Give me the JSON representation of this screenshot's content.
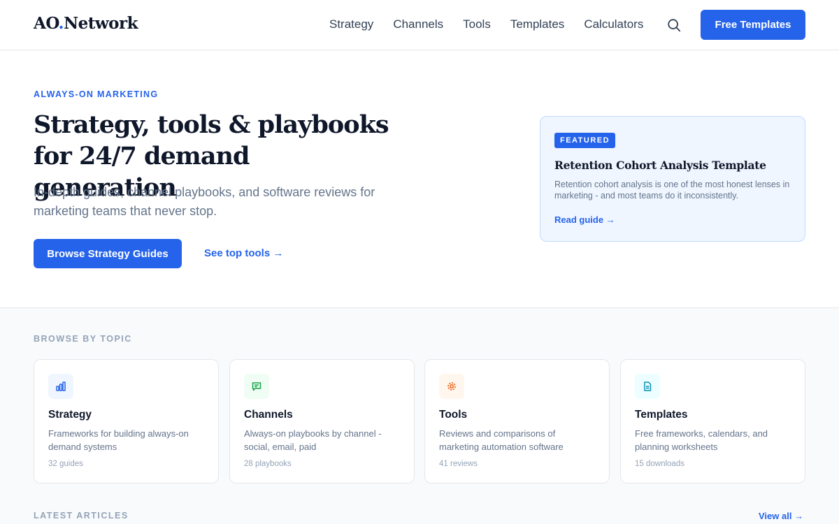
{
  "header": {
    "logo_main": "AO",
    "logo_dot": ".",
    "logo_rest": "Network",
    "nav": [
      "Strategy",
      "Channels",
      "Tools",
      "Templates",
      "Calculators"
    ],
    "cta": "Free Templates",
    "search_icon": "search-icon"
  },
  "hero": {
    "eyebrow": "ALWAYS-ON MARKETING",
    "title_line1": "Strategy, tools & playbooks",
    "title_line2": "for 24/7 demand generation",
    "subtitle": "In-depth guides, channel playbooks, and software reviews for marketing teams that never stop.",
    "primary_button": "Browse Strategy Guides",
    "secondary_link": "See top tools →"
  },
  "featured": {
    "badge": "FEATURED",
    "title": "Retention Cohort Analysis Template",
    "description": "Retention cohort analysis is one of the most honest lenses in marketing - and most teams do it inconsistently.",
    "link": "Read guide →"
  },
  "topics": {
    "label": "BROWSE BY TOPIC",
    "cards": [
      {
        "title": "Strategy",
        "description": "Frameworks for building always-on demand systems",
        "count": "32 guides",
        "icon": "bar-chart-icon",
        "color": "#2563eb",
        "bg": "#eff6ff"
      },
      {
        "title": "Channels",
        "description": "Always-on playbooks by channel - social, email, paid",
        "count": "28 playbooks",
        "icon": "chat-icon",
        "color": "#16a34a",
        "bg": "#f0fdf4"
      },
      {
        "title": "Tools",
        "description": "Reviews and comparisons of marketing automation software",
        "count": "41 reviews",
        "icon": "gear-icon",
        "color": "#ea580c",
        "bg": "#fff7ed"
      },
      {
        "title": "Templates",
        "description": "Free frameworks, calendars, and planning worksheets",
        "count": "15 downloads",
        "icon": "document-icon",
        "color": "#0891b2",
        "bg": "#ecfeff"
      }
    ]
  },
  "latest": {
    "label": "LATEST ARTICLES",
    "view_all": "View all →"
  },
  "colors": {
    "accent": "#2563eb",
    "text": "#0f172a",
    "muted": "#64748b"
  }
}
